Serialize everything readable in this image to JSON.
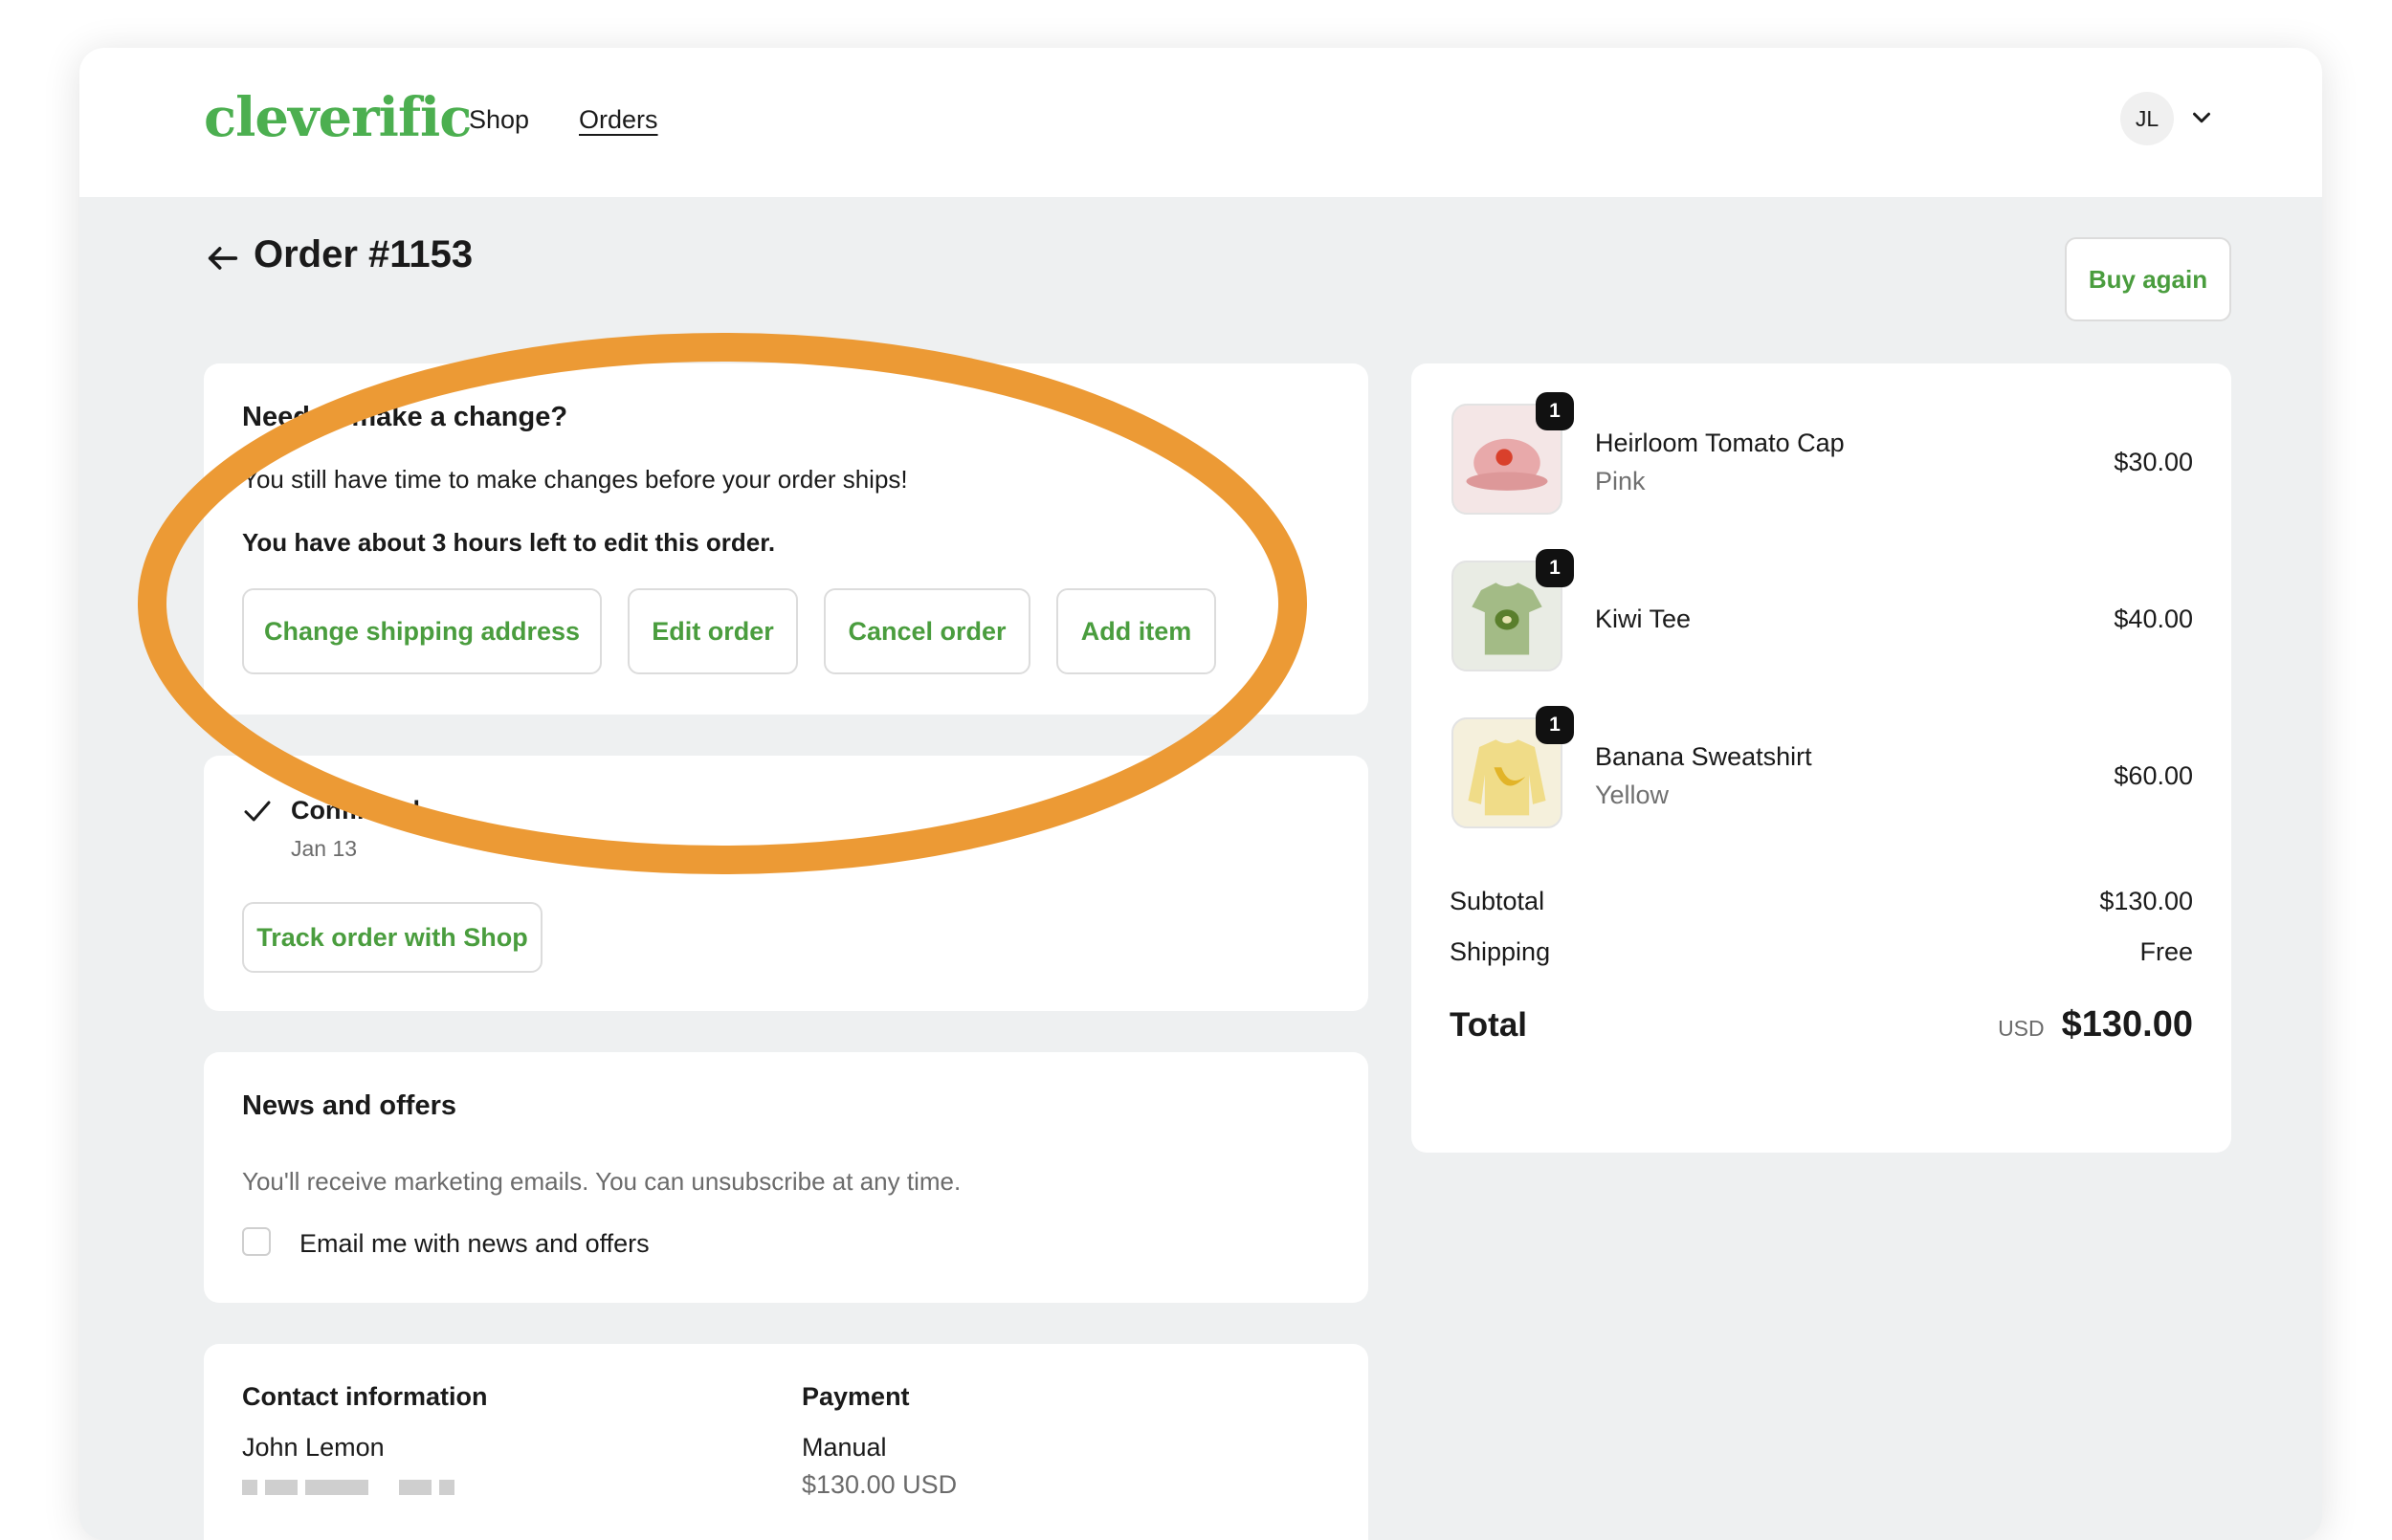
{
  "header": {
    "logo": "cleverific",
    "nav": [
      {
        "label": "Shop"
      },
      {
        "label": "Orders"
      }
    ],
    "avatar_initials": "JL"
  },
  "page": {
    "title": "Order #1153",
    "buy_again_label": "Buy again"
  },
  "change_card": {
    "heading": "Need to make a change?",
    "body": "You still have time to make changes before your order ships!",
    "time_left": "You have about 3 hours left to edit this order.",
    "buttons": [
      "Change shipping address",
      "Edit order",
      "Cancel order",
      "Add item"
    ]
  },
  "status_card": {
    "status": "Confirmed",
    "date": "Jan 13",
    "track_label": "Track order with Shop"
  },
  "news_card": {
    "heading": "News and offers",
    "body": "You'll receive marketing emails. You can unsubscribe at any time.",
    "checkbox_label": "Email me with news and offers",
    "checked": false
  },
  "info_card": {
    "contact_heading": "Contact information",
    "contact_name": "John Lemon",
    "payment_heading": "Payment",
    "payment_method": "Manual",
    "payment_amount": "$130.00 USD"
  },
  "summary": {
    "items": [
      {
        "name": "Heirloom Tomato Cap",
        "variant": "Pink",
        "price": "$30.00",
        "qty": "1",
        "thumb_color": "#e8b9b9"
      },
      {
        "name": "Kiwi Tee",
        "variant": "",
        "price": "$40.00",
        "qty": "1",
        "thumb_color": "#a8c08a"
      },
      {
        "name": "Banana Sweatshirt",
        "variant": "Yellow",
        "price": "$60.00",
        "qty": "1",
        "thumb_color": "#f0de8a"
      }
    ],
    "subtotal_label": "Subtotal",
    "subtotal": "$130.00",
    "shipping_label": "Shipping",
    "shipping": "Free",
    "total_label": "Total",
    "currency": "USD",
    "total": "$130.00"
  },
  "colors": {
    "accent": "#4a9d3e",
    "highlight": "#ec9a35"
  }
}
